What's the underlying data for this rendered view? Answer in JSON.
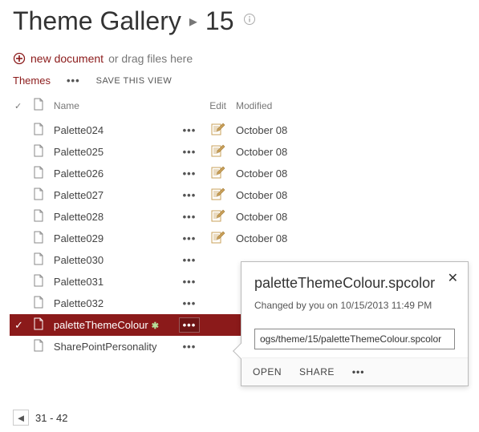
{
  "header": {
    "title": "Theme Gallery",
    "crumb": "15",
    "chevron": "▸"
  },
  "newdoc": {
    "link": "new document",
    "suffix": "or drag files here"
  },
  "toolbar": {
    "tab": "Themes",
    "save_view": "SAVE THIS VIEW"
  },
  "columns": {
    "name": "Name",
    "edit": "Edit",
    "modified": "Modified"
  },
  "files": [
    {
      "name": "Palette024",
      "modified": "October 08",
      "selected": false,
      "is_new": false,
      "show_meta": true
    },
    {
      "name": "Palette025",
      "modified": "October 08",
      "selected": false,
      "is_new": false,
      "show_meta": true
    },
    {
      "name": "Palette026",
      "modified": "October 08",
      "selected": false,
      "is_new": false,
      "show_meta": true
    },
    {
      "name": "Palette027",
      "modified": "October 08",
      "selected": false,
      "is_new": false,
      "show_meta": true
    },
    {
      "name": "Palette028",
      "modified": "October 08",
      "selected": false,
      "is_new": false,
      "show_meta": true
    },
    {
      "name": "Palette029",
      "modified": "October 08",
      "selected": false,
      "is_new": false,
      "show_meta": true
    },
    {
      "name": "Palette030",
      "modified": "",
      "selected": false,
      "is_new": false,
      "show_meta": false
    },
    {
      "name": "Palette031",
      "modified": "",
      "selected": false,
      "is_new": false,
      "show_meta": false
    },
    {
      "name": "Palette032",
      "modified": "",
      "selected": false,
      "is_new": false,
      "show_meta": false
    },
    {
      "name": "paletteThemeColour",
      "modified": "",
      "selected": true,
      "is_new": true,
      "show_meta": false
    },
    {
      "name": "SharePointPersonality",
      "modified": "",
      "selected": false,
      "is_new": false,
      "show_meta": false
    }
  ],
  "pager": {
    "range": "31 - 42"
  },
  "callout": {
    "title": "paletteThemeColour.spcolor",
    "subtitle": "Changed by you on 10/15/2013 11:49 PM",
    "url": "ogs/theme/15/paletteThemeColour.spcolor",
    "open": "OPEN",
    "share": "SHARE"
  },
  "glyphs": {
    "check": "✓",
    "new_badge": "✱",
    "dots": "•••",
    "close": "✕",
    "prev": "◄"
  }
}
